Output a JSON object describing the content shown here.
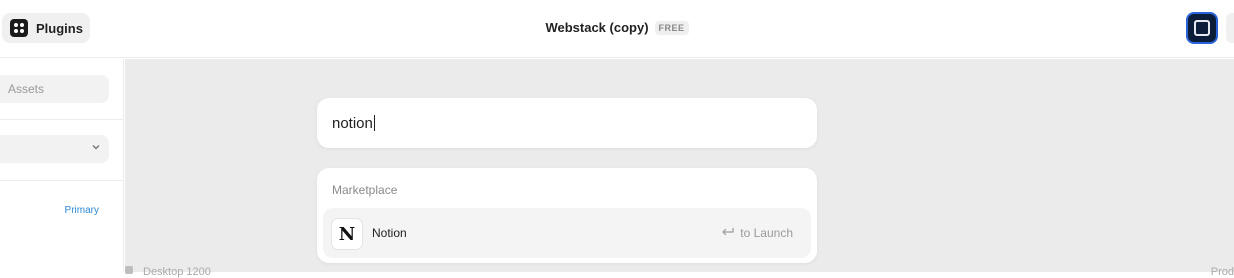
{
  "topbar": {
    "plugins_label": "Plugins",
    "project_name": "Webstack (copy)",
    "plan_badge": "FREE"
  },
  "sidebar": {
    "assets_label": "Assets",
    "primary_label": "Primary"
  },
  "canvas": {
    "footer_left": "Desktop 1200",
    "footer_right": "Prod"
  },
  "search": {
    "query": "notion"
  },
  "results": {
    "section_title": "Marketplace",
    "items": [
      {
        "name": "Notion",
        "icon": "notion-logo",
        "hint": "to Launch"
      }
    ]
  },
  "colors": {
    "accent_link": "#2d8ad6",
    "canvas_bg": "#ebebeb",
    "avatar_border": "#2a64d8"
  }
}
